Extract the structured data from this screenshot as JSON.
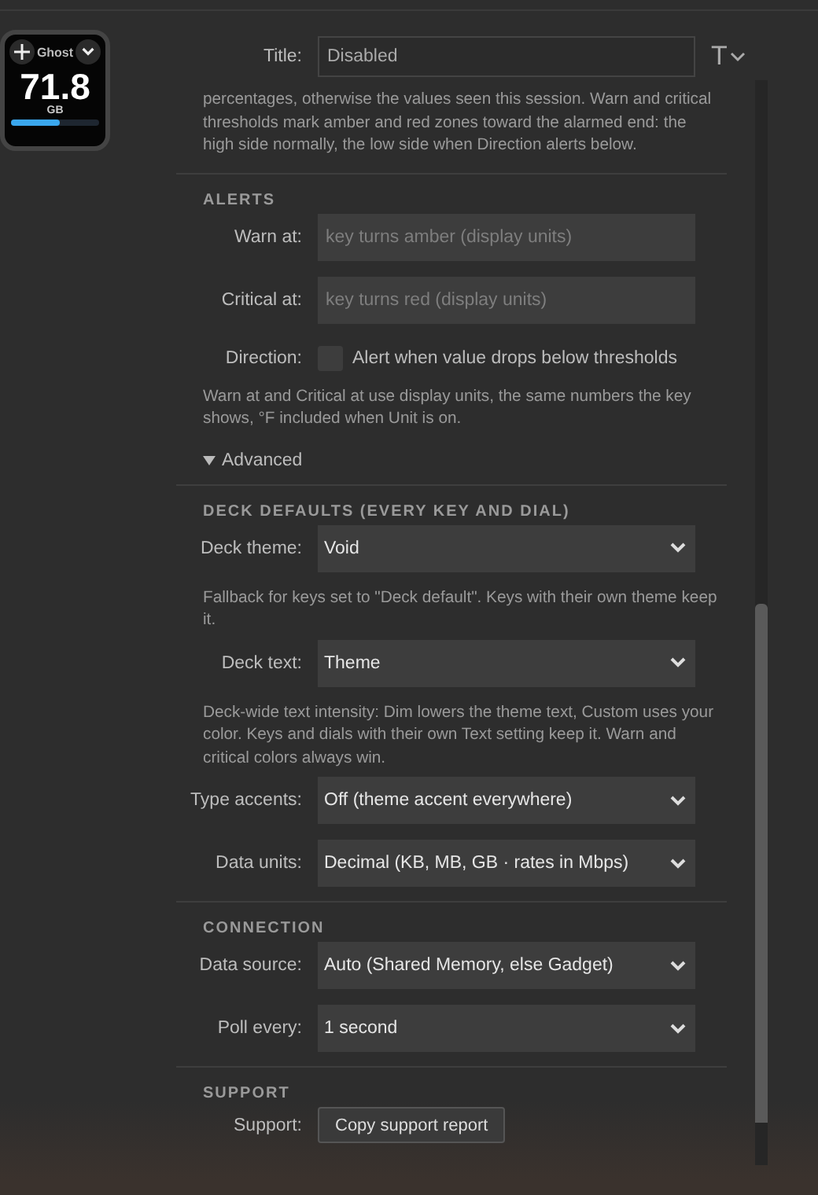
{
  "key": {
    "title": "Ghost",
    "value": "71.8",
    "unit": "GB",
    "level": 0.55
  },
  "title_field": {
    "label": "Title:",
    "value": "Disabled",
    "style_button": "T"
  },
  "intro": "percentages, otherwise the values seen this session. Warn and critical thresholds mark amber and red zones toward the alarmed end: the high side normally, the low side when Direction alerts below.",
  "items": [
    {
      "kind": "heading",
      "text": "ALERTS"
    },
    {
      "kind": "field",
      "label": "Warn at:",
      "placeholder": "key turns amber (display units)"
    },
    {
      "kind": "field",
      "label": "Critical at:",
      "placeholder": "key turns red (display units)"
    },
    {
      "kind": "checkbox",
      "label": "Direction:",
      "text": "Alert when value drops below thresholds",
      "checked": false
    },
    {
      "kind": "note",
      "text": "Warn at and Critical at use display units, the same numbers the key shows, °F included when Unit is on."
    },
    {
      "kind": "toggle",
      "text": "Advanced",
      "expanded": true
    },
    {
      "kind": "heading",
      "text": "DECK DEFAULTS (EVERY KEY AND DIAL)"
    },
    {
      "kind": "select",
      "label": "Deck theme:",
      "value": "Void"
    },
    {
      "kind": "note",
      "text": "Fallback for keys set to \"Deck default\". Keys with their own theme keep it."
    },
    {
      "kind": "select",
      "label": "Deck text:",
      "value": "Theme"
    },
    {
      "kind": "note",
      "text": "Deck-wide text intensity: Dim lowers the theme text, Custom uses your color. Keys and dials with their own Text setting keep it. Warn and critical colors always win."
    },
    {
      "kind": "select",
      "label": "Type accents:",
      "value": "Off (theme accent everywhere)"
    },
    {
      "kind": "select",
      "label": "Data units:",
      "value": "Decimal (KB, MB, GB · rates in Mbps)"
    },
    {
      "kind": "heading",
      "text": "CONNECTION"
    },
    {
      "kind": "select",
      "label": "Data source:",
      "value": "Auto (Shared Memory, else Gadget)"
    },
    {
      "kind": "select",
      "label": "Poll every:",
      "value": "1 second"
    },
    {
      "kind": "heading",
      "text": "SUPPORT"
    },
    {
      "kind": "button",
      "label": "Support:",
      "text": "Copy support report"
    }
  ]
}
